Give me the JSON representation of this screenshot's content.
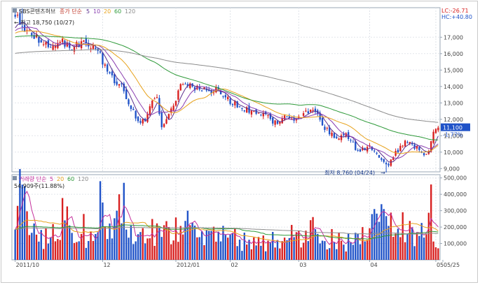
{
  "chart_data": [
    {
      "type": "candlestick",
      "title": "SBS콘텐츠허브",
      "legend": {
        "label": "종가 단순",
        "periods": [
          "5",
          "10",
          "20",
          "60",
          "120"
        ],
        "colors": [
          "#5a2d8c",
          "#8a3fb0",
          "#e7a21c",
          "#2f9a3a",
          "#8c8c8c"
        ]
      },
      "x_tick_labels": [
        "2011/10",
        "12",
        "2012/01",
        "02",
        "03",
        "04",
        "05",
        "05/25"
      ],
      "y_ticks": [
        "17,000",
        "16,000",
        "15,000",
        "14,000",
        "13,000",
        "12,000",
        "11,000",
        "10,000",
        "9,000"
      ],
      "ylim": [
        8800,
        18800
      ],
      "top_right": {
        "line1": "LC:-26.71",
        "line2": "HC:+40.80"
      },
      "current_price_label": "11,100",
      "current_change_label": "-1.77%",
      "annotations": {
        "high": "최고 18,750 (10/27)",
        "low": "최저 8,760 (04/24)"
      },
      "close_anchors": [
        [
          0,
          18300
        ],
        [
          5,
          17300
        ],
        [
          10,
          16900
        ],
        [
          15,
          16500
        ],
        [
          20,
          16700
        ],
        [
          25,
          16400
        ],
        [
          30,
          16800
        ],
        [
          35,
          16200
        ],
        [
          40,
          14600
        ],
        [
          45,
          14000
        ],
        [
          50,
          12500
        ],
        [
          52,
          11900
        ],
        [
          55,
          12000
        ],
        [
          58,
          13300
        ],
        [
          60,
          13200
        ],
        [
          62,
          11500
        ],
        [
          65,
          12300
        ],
        [
          68,
          13300
        ],
        [
          70,
          14300
        ],
        [
          75,
          14000
        ],
        [
          80,
          13800
        ],
        [
          85,
          13800
        ],
        [
          90,
          13200
        ],
        [
          95,
          12800
        ],
        [
          100,
          12400
        ],
        [
          105,
          12300
        ],
        [
          110,
          11800
        ],
        [
          115,
          12200
        ],
        [
          120,
          12000
        ],
        [
          125,
          12600
        ],
        [
          127,
          12500
        ],
        [
          130,
          11600
        ],
        [
          135,
          10900
        ],
        [
          140,
          11000
        ],
        [
          145,
          10100
        ],
        [
          150,
          10400
        ],
        [
          155,
          9600
        ],
        [
          158,
          9300
        ],
        [
          160,
          9800
        ],
        [
          165,
          10600
        ],
        [
          170,
          10300
        ],
        [
          173,
          9900
        ],
        [
          175,
          10000
        ],
        [
          177,
          11300
        ],
        [
          178,
          11400
        ]
      ],
      "ma_start": {
        "ma5": 17400,
        "ma10": 17300,
        "ma20": 17200,
        "ma60": 17000,
        "ma120": 16000
      }
    },
    {
      "type": "bar",
      "title": "거래량 단순",
      "legend": {
        "label": "거래량 단순",
        "periods": [
          "5",
          "20",
          "60",
          "120"
        ],
        "colors": [
          "#c42f9c",
          "#e7a21c",
          "#2f9a3a",
          "#8c8c8c"
        ]
      },
      "summary_label": "54,909주(11.88%)",
      "y_ticks": [
        "500,000",
        "400,000",
        "300,000",
        "200,000",
        "100,000"
      ],
      "ylim": [
        0,
        520000
      ],
      "volume_anchors": [
        [
          0,
          200000
        ],
        [
          3,
          450000
        ],
        [
          6,
          220000
        ],
        [
          10,
          120000
        ],
        [
          15,
          180000
        ],
        [
          20,
          250000
        ],
        [
          25,
          160000
        ],
        [
          30,
          140000
        ],
        [
          35,
          170000
        ],
        [
          40,
          180000
        ],
        [
          45,
          160000
        ],
        [
          50,
          200000
        ],
        [
          55,
          210000
        ],
        [
          60,
          180000
        ],
        [
          65,
          170000
        ],
        [
          70,
          180000
        ],
        [
          75,
          160000
        ],
        [
          80,
          150000
        ],
        [
          85,
          140000
        ],
        [
          90,
          130000
        ],
        [
          95,
          120000
        ],
        [
          100,
          120000
        ],
        [
          105,
          110000
        ],
        [
          110,
          110000
        ],
        [
          115,
          130000
        ],
        [
          120,
          150000
        ],
        [
          125,
          180000
        ],
        [
          130,
          150000
        ],
        [
          135,
          120000
        ],
        [
          140,
          110000
        ],
        [
          145,
          140000
        ],
        [
          150,
          200000
        ],
        [
          155,
          220000
        ],
        [
          160,
          190000
        ],
        [
          165,
          210000
        ],
        [
          170,
          180000
        ],
        [
          175,
          200000
        ],
        [
          178,
          60000
        ]
      ],
      "spikes": [
        [
          4,
          450000
        ],
        [
          29,
          280000
        ],
        [
          36,
          480000
        ],
        [
          37,
          350000
        ],
        [
          43,
          300000
        ],
        [
          44,
          400000
        ],
        [
          46,
          470000
        ],
        [
          62,
          140000
        ],
        [
          73,
          300000
        ],
        [
          152,
          310000
        ],
        [
          156,
          310000
        ],
        [
          176,
          460000
        ]
      ]
    }
  ]
}
